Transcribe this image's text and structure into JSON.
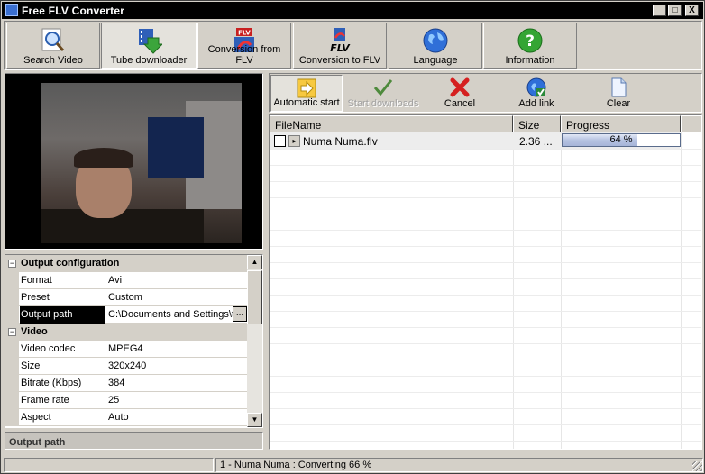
{
  "window": {
    "title": "Free FLV Converter",
    "minimize": "_",
    "maximize": "□",
    "close": "X"
  },
  "toolbar": {
    "items": [
      {
        "label": "Search Video",
        "icon": "magnifier-icon"
      },
      {
        "label": "Tube downloader",
        "icon": "download-arrow-icon"
      },
      {
        "label": "Conversion from FLV",
        "icon": "flv-convert-from-icon"
      },
      {
        "label": "Conversion to FLV",
        "icon": "flv-convert-to-icon"
      },
      {
        "label": "Language",
        "icon": "globe-icon"
      },
      {
        "label": "Information",
        "icon": "help-icon"
      }
    ],
    "active": "Tube downloader"
  },
  "properties": {
    "groups": [
      {
        "title": "Output configuration",
        "rows": [
          {
            "key": "Format",
            "value": "Avi"
          },
          {
            "key": "Preset",
            "value": "Custom"
          },
          {
            "key": "Output path",
            "value": "C:\\Documents and Settings\\t",
            "ellipsis": "..."
          }
        ]
      },
      {
        "title": "Video",
        "rows": [
          {
            "key": "Video codec",
            "value": "MPEG4"
          },
          {
            "key": "Size",
            "value": "320x240"
          },
          {
            "key": "Bitrate (Kbps)",
            "value": "384"
          },
          {
            "key": "Frame rate",
            "value": "25"
          },
          {
            "key": "Aspect",
            "value": "Auto"
          }
        ]
      }
    ],
    "collapse_symbol": "−",
    "help_title": "Output path"
  },
  "downloads_toolbar": {
    "automatic_start": "Automatic start",
    "start_downloads": "Start downloads",
    "cancel": "Cancel",
    "add_link": "Add link",
    "clear": "Clear"
  },
  "list": {
    "columns": [
      "FileName",
      "Size",
      "Progress"
    ],
    "rows": [
      {
        "name": "Numa Numa.flv",
        "size": "2.36 ...",
        "progress": 0.64,
        "progress_text": "64 %"
      }
    ]
  },
  "status": {
    "left": "",
    "message": "1 - Numa Numa : Converting  66 %"
  },
  "colors": {
    "titlebar": "#000000",
    "progress_fill": "#b6c3e1",
    "panel": "#d4d0c8"
  }
}
